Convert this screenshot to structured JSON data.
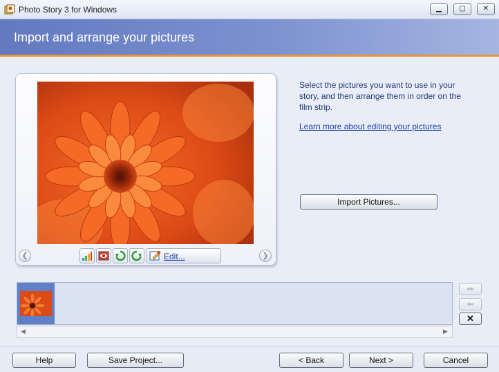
{
  "window": {
    "title": "Photo Story 3 for Windows",
    "icons": {
      "app": "photo-story-icon",
      "minimize": "minimize-icon",
      "maximize": "maximize-icon",
      "close": "close-icon"
    }
  },
  "header": {
    "title": "Import and arrange your pictures"
  },
  "preview": {
    "image": "orange-flower-photo",
    "tools": [
      "auto-color-correct-icon",
      "red-eye-icon",
      "rotate-left-icon",
      "rotate-right-icon",
      "edit-icon"
    ],
    "edit_label": "Edit..."
  },
  "instructions": {
    "text": "Select the pictures you want to use in your story, and then arrange them in order on the film strip.",
    "learn_more": "Learn more about editing your pictures",
    "import_label": "Import Pictures..."
  },
  "filmstrip": {
    "selected_index": 0,
    "thumbnails": [
      "orange-flower-photo"
    ],
    "controls": [
      "move-right-icon",
      "move-left-icon",
      "delete-icon"
    ],
    "delete_glyph": "✕"
  },
  "footer": {
    "help": "Help",
    "save_project": "Save Project...",
    "back": "< Back",
    "next": "Next >",
    "cancel": "Cancel"
  },
  "colors": {
    "header_start": "#6279c0",
    "header_end": "#a6b5e1",
    "header_accent": "#e8963a",
    "link": "#1b3fa7",
    "thumb_selected": "#5f7fc6"
  }
}
